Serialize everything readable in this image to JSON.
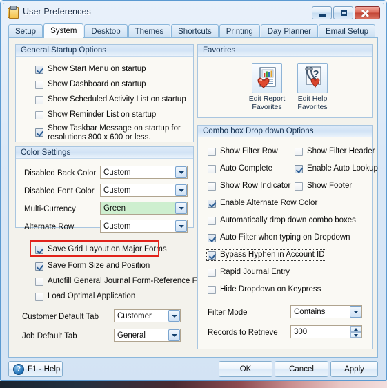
{
  "window": {
    "title": "User Preferences",
    "icon": "clipboard-icon",
    "minimize_label": "Minimize",
    "maximize_label": "Maximize",
    "close_label": "Close"
  },
  "tabs": [
    {
      "label": "Setup",
      "active": false
    },
    {
      "label": "System",
      "active": true
    },
    {
      "label": "Desktop",
      "active": false
    },
    {
      "label": "Themes",
      "active": false
    },
    {
      "label": "Shortcuts",
      "active": false
    },
    {
      "label": "Printing",
      "active": false
    },
    {
      "label": "Day Planner",
      "active": false
    },
    {
      "label": "Email Setup",
      "active": false
    }
  ],
  "general_startup": {
    "title": "General Startup Options",
    "items": [
      {
        "label": "Show Start Menu on startup",
        "checked": true
      },
      {
        "label": "Show Dashboard on startup",
        "checked": false
      },
      {
        "label": "Show Scheduled Activity List on startup",
        "checked": false
      },
      {
        "label": "Show Reminder List on startup",
        "checked": false
      },
      {
        "label": "Show Taskbar Message on startup for resolutions 800 x 600 or less.",
        "checked": true
      }
    ]
  },
  "color_settings": {
    "title": "Color Settings",
    "rows": [
      {
        "label": "Disabled Back Color",
        "value": "Custom",
        "highlight": false
      },
      {
        "label": "Disabled Font Color",
        "value": "Custom",
        "highlight": false
      },
      {
        "label": "Multi-Currency",
        "value": "Green",
        "highlight": true
      },
      {
        "label": "Alternate Row",
        "value": "Custom",
        "highlight": false
      }
    ]
  },
  "form_options": {
    "items": [
      {
        "label": "Save Grid Layout on Major Forms",
        "checked": true,
        "highlighted": true
      },
      {
        "label": "Save Form Size and Position",
        "checked": true,
        "highlighted": false
      },
      {
        "label": "Autofill General Journal Form-Reference Field",
        "checked": false,
        "highlighted": false
      },
      {
        "label": "Load Optimal Application",
        "checked": false,
        "highlighted": false
      }
    ],
    "selects": [
      {
        "label": "Customer Default Tab",
        "value": "Customer"
      },
      {
        "label": "Job Default Tab",
        "value": "General"
      }
    ]
  },
  "favorites": {
    "title": "Favorites",
    "buttons": [
      {
        "icon": "report-favorites-icon",
        "caption_line1": "Edit Report",
        "caption_line2": "Favorites"
      },
      {
        "icon": "help-favorites-icon",
        "caption_line1": "Edit Help",
        "caption_line2": "Favorites"
      }
    ]
  },
  "combo_options": {
    "title": "Combo box Drop down Options",
    "two_column_rows": [
      {
        "left": {
          "label": "Show Filter Row",
          "checked": false
        },
        "right": {
          "label": "Show Filter Header",
          "checked": false
        }
      },
      {
        "left": {
          "label": "Auto Complete",
          "checked": false
        },
        "right": {
          "label": "Enable Auto Lookup",
          "checked": true
        }
      },
      {
        "left": {
          "label": "Show Row Indicator",
          "checked": false
        },
        "right": {
          "label": "Show Footer",
          "checked": false
        }
      }
    ],
    "full_rows": [
      {
        "label": "Enable Alternate Row Color",
        "checked": true,
        "focused": false
      },
      {
        "label": "Automatically drop down combo boxes",
        "checked": false,
        "focused": false
      },
      {
        "label": "Auto Filter when typing on Dropdown",
        "checked": true,
        "focused": false
      },
      {
        "label": "Bypass Hyphen in Account ID",
        "checked": true,
        "focused": true
      },
      {
        "label": "Rapid Journal Entry",
        "checked": false,
        "focused": false
      },
      {
        "label": "Hide Dropdown on Keypress",
        "checked": false,
        "focused": false
      }
    ],
    "filter_mode": {
      "label": "Filter Mode",
      "value": "Contains"
    },
    "records_to_retrieve": {
      "label": "Records to Retrieve",
      "value": "300"
    }
  },
  "footer": {
    "help": "F1 - Help",
    "help_icon": "question-mark-icon",
    "ok": "OK",
    "cancel": "Cancel",
    "apply": "Apply"
  },
  "colors": {
    "accent": "#5b9ad1",
    "highlight_rect": "#e2231a",
    "green_field": "#ceefcf",
    "page_bg": "#f3f2ec"
  }
}
